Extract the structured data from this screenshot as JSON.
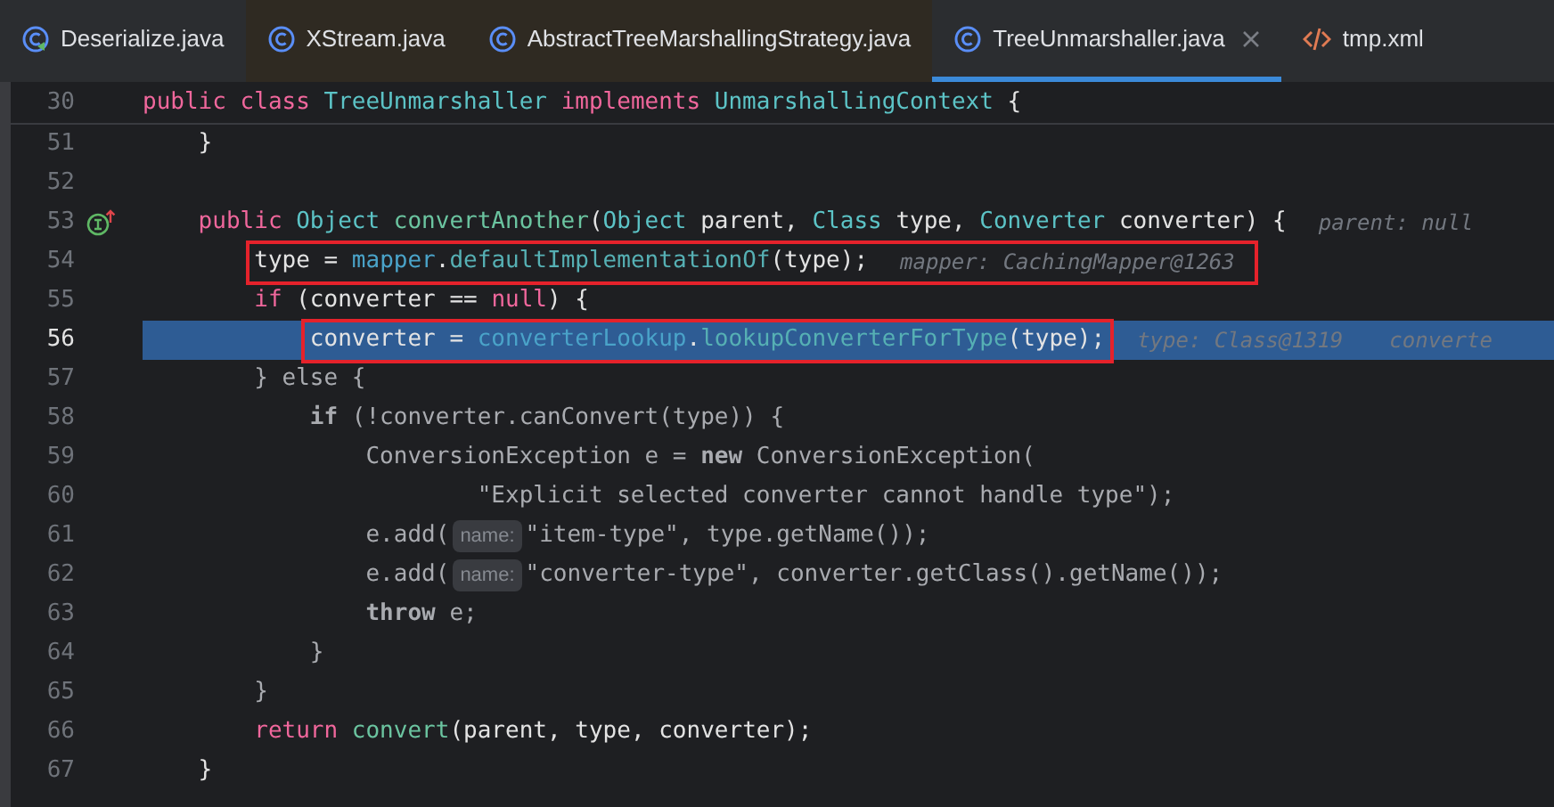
{
  "tabs": [
    {
      "label": "Deserialize.java",
      "kind": "runnable",
      "library": false,
      "selected": false,
      "closable": false
    },
    {
      "label": "XStream.java",
      "kind": "class",
      "library": true,
      "selected": false,
      "closable": false
    },
    {
      "label": "AbstractTreeMarshallingStrategy.java",
      "kind": "class",
      "library": true,
      "selected": false,
      "closable": false
    },
    {
      "label": "TreeUnmarshaller.java",
      "kind": "class",
      "library": false,
      "selected": true,
      "closable": true
    },
    {
      "label": "tmp.xml",
      "kind": "xml",
      "library": false,
      "selected": false,
      "closable": false
    }
  ],
  "sticky_line": {
    "number": "30",
    "tokens": [
      {
        "kind": "kw",
        "text": "public class "
      },
      {
        "kind": "type",
        "text": "TreeUnmarshaller "
      },
      {
        "kind": "kw",
        "text": "implements "
      },
      {
        "kind": "type",
        "text": "UnmarshallingContext"
      },
      {
        "kind": "text",
        "text": " {"
      }
    ]
  },
  "lines": [
    {
      "number": "51",
      "current": false,
      "gutter_icon": false,
      "segments": [
        {
          "framed": false,
          "tokens": [
            {
              "kind": "text",
              "text": "    }"
            }
          ]
        }
      ]
    },
    {
      "number": "52",
      "current": false,
      "gutter_icon": false
    },
    {
      "number": "53",
      "current": false,
      "gutter_icon": true,
      "segments": [
        {
          "framed": false,
          "tokens": [
            {
              "kind": "kw",
              "text": "    public "
            },
            {
              "kind": "type",
              "text": "Object "
            },
            {
              "kind": "fn",
              "text": "convertAnother"
            },
            {
              "kind": "text",
              "text": "("
            },
            {
              "kind": "type",
              "text": "Object "
            },
            {
              "kind": "text",
              "text": "parent, "
            },
            {
              "kind": "type",
              "text": "Class "
            },
            {
              "kind": "text",
              "text": "type, "
            },
            {
              "kind": "type",
              "text": "Converter "
            },
            {
              "kind": "text",
              "text": "converter) {"
            },
            {
              "kind": "hint",
              "text": "parent: null"
            }
          ]
        }
      ]
    },
    {
      "number": "54",
      "current": false,
      "gutter_icon": false,
      "segments": [
        {
          "framed": true,
          "tokens": [
            {
              "kind": "text",
              "text": "type = "
            },
            {
              "kind": "field",
              "text": "mapper"
            },
            {
              "kind": "text",
              "text": "."
            },
            {
              "kind": "method",
              "text": "defaultImplementationOf"
            },
            {
              "kind": "text",
              "text": "(type);"
            },
            {
              "kind": "hint",
              "text": "mapper: CachingMapper@1263"
            }
          ]
        }
      ]
    },
    {
      "number": "55",
      "current": false,
      "gutter_icon": false,
      "segments": [
        {
          "framed": false,
          "tokens": [
            {
              "kind": "kw",
              "text": "        if"
            },
            {
              "kind": "text",
              "text": " (converter == "
            },
            {
              "kind": "kw",
              "text": "null"
            },
            {
              "kind": "text",
              "text": ") {"
            }
          ]
        }
      ]
    },
    {
      "number": "56",
      "current": true,
      "gutter_icon": false,
      "segments": [
        {
          "framed": true,
          "tokens": [
            {
              "kind": "text",
              "text": "converter = "
            },
            {
              "kind": "field",
              "text": "converterLookup"
            },
            {
              "kind": "text",
              "text": "."
            },
            {
              "kind": "method",
              "text": "lookupConverterForType"
            },
            {
              "kind": "text",
              "text": "(type);"
            }
          ]
        },
        {
          "framed": false,
          "tokens": [
            {
              "kind": "hint",
              "text": "type: Class@1319"
            },
            {
              "kind": "hint",
              "text": "converte"
            }
          ]
        }
      ]
    },
    {
      "number": "57",
      "current": false,
      "gutter_icon": false,
      "segments": [
        {
          "framed": false,
          "tokens": [
            {
              "kind": "dim",
              "text": "        } else {"
            }
          ]
        }
      ]
    },
    {
      "number": "58",
      "current": false,
      "gutter_icon": false,
      "segments": [
        {
          "framed": false,
          "tokens": [
            {
              "kind": "dimkw",
              "text": "            if"
            },
            {
              "kind": "dim",
              "text": " (!converter.canConvert(type)) {"
            }
          ]
        }
      ]
    },
    {
      "number": "59",
      "current": false,
      "gutter_icon": false,
      "segments": [
        {
          "framed": false,
          "tokens": [
            {
              "kind": "dim",
              "text": "                ConversionException e = "
            },
            {
              "kind": "dimkw",
              "text": "new"
            },
            {
              "kind": "dim",
              "text": " ConversionException("
            }
          ]
        }
      ]
    },
    {
      "number": "60",
      "current": false,
      "gutter_icon": false,
      "segments": [
        {
          "framed": false,
          "tokens": [
            {
              "kind": "dim",
              "text": "                        \"Explicit selected converter cannot handle type\");"
            }
          ]
        }
      ]
    },
    {
      "number": "61",
      "current": false,
      "gutter_icon": false,
      "segments": [
        {
          "framed": false,
          "tokens": [
            {
              "kind": "dim",
              "text": "                e.add("
            },
            {
              "kind": "inlay",
              "text": "name:"
            },
            {
              "kind": "dim",
              "text": "\"item-type\", type.getName());"
            }
          ]
        }
      ]
    },
    {
      "number": "62",
      "current": false,
      "gutter_icon": false,
      "segments": [
        {
          "framed": false,
          "tokens": [
            {
              "kind": "dim",
              "text": "                e.add("
            },
            {
              "kind": "inlay",
              "text": "name:"
            },
            {
              "kind": "dim",
              "text": "\"converter-type\", converter.getClass().getName());"
            }
          ]
        }
      ]
    },
    {
      "number": "63",
      "current": false,
      "gutter_icon": false,
      "segments": [
        {
          "framed": false,
          "tokens": [
            {
              "kind": "dimkw",
              "text": "                throw"
            },
            {
              "kind": "dim",
              "text": " e;"
            }
          ]
        }
      ]
    },
    {
      "number": "64",
      "current": false,
      "gutter_icon": false,
      "segments": [
        {
          "framed": false,
          "tokens": [
            {
              "kind": "dim",
              "text": "            }"
            }
          ]
        }
      ]
    },
    {
      "number": "65",
      "current": false,
      "gutter_icon": false,
      "segments": [
        {
          "framed": false,
          "tokens": [
            {
              "kind": "dim",
              "text": "        }"
            }
          ]
        }
      ]
    },
    {
      "number": "66",
      "current": false,
      "gutter_icon": false,
      "segments": [
        {
          "framed": false,
          "tokens": [
            {
              "kind": "kw",
              "text": "        return "
            },
            {
              "kind": "fn",
              "text": "convert"
            },
            {
              "kind": "text",
              "text": "(parent, type, converter);"
            }
          ]
        }
      ]
    },
    {
      "number": "67",
      "current": false,
      "gutter_icon": false,
      "segments": [
        {
          "framed": false,
          "tokens": [
            {
              "kind": "text",
              "text": "    }"
            }
          ]
        }
      ]
    }
  ]
}
